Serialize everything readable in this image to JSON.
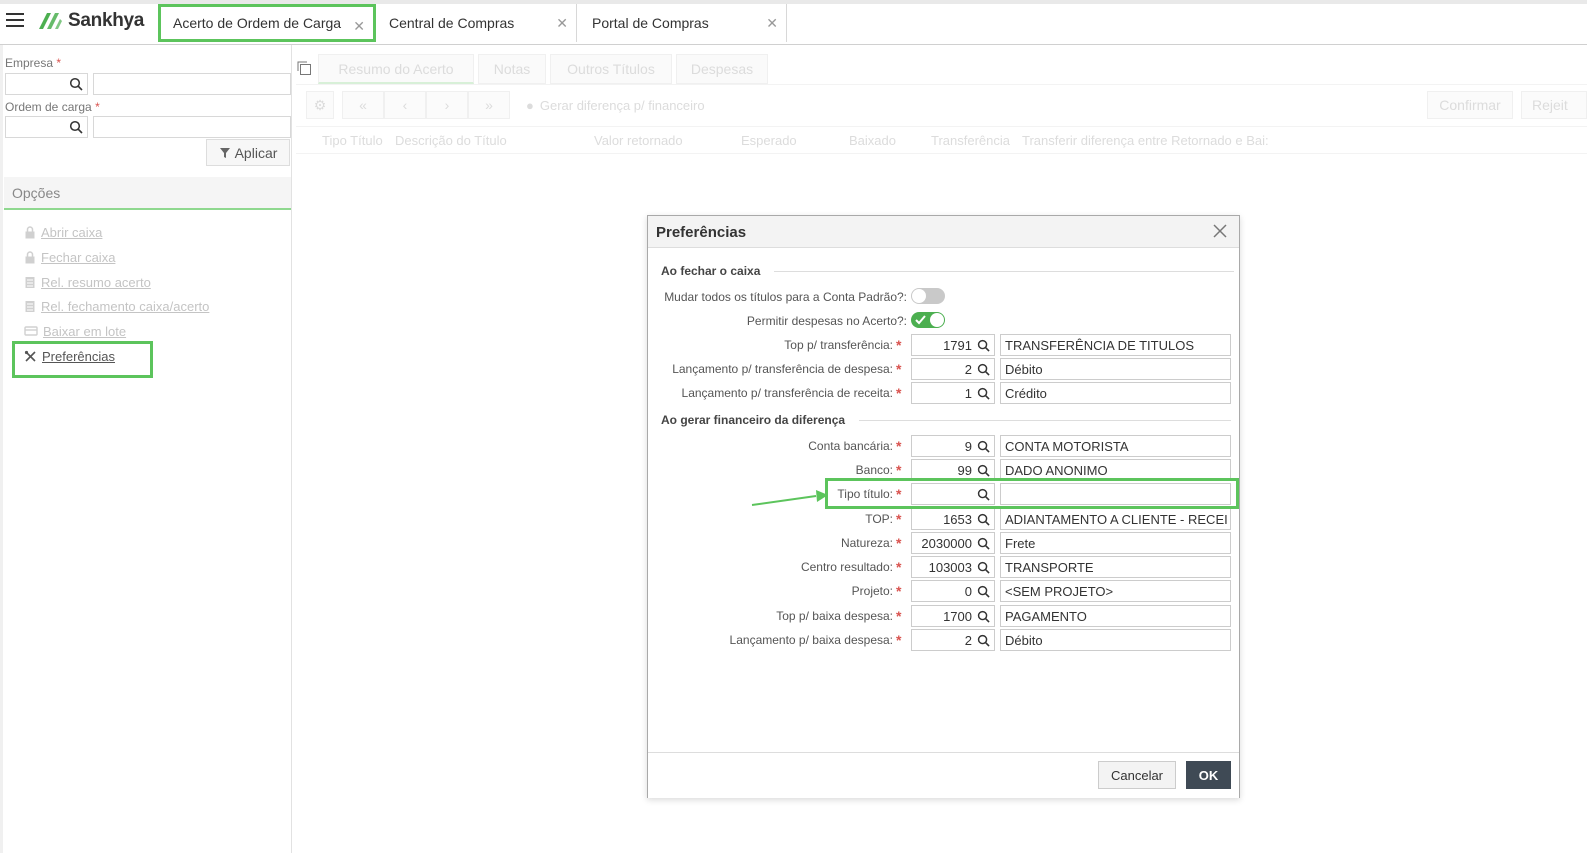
{
  "app": {
    "logo_text": "Sankhya",
    "accent_color": "#5cc45c"
  },
  "tabs": [
    {
      "label": "Acerto de Ordem de Carga",
      "close": "✕",
      "active": true
    },
    {
      "label": "Central de Compras",
      "close": "✕"
    },
    {
      "label": "Portal de Compras",
      "close": "✕"
    }
  ],
  "filters": {
    "empresa_label": "Empresa",
    "ordem_label": "Ordem de carga",
    "required_mark": "*",
    "aplicar_label": "Aplicar"
  },
  "options": {
    "header": "Opções",
    "items": [
      {
        "label": "Abrir caixa",
        "icon": "lock-icon"
      },
      {
        "label": "Fechar caixa",
        "icon": "lock-icon"
      },
      {
        "label": "Rel. resumo acerto",
        "icon": "report-icon"
      },
      {
        "label": "Rel. fechamento caixa/acerto",
        "icon": "report-icon"
      },
      {
        "label": "Baixar em lote",
        "icon": "card-icon"
      },
      {
        "label": "Preferências",
        "icon": "tools-icon"
      }
    ]
  },
  "main": {
    "tabs": [
      "Resumo do Acerto",
      "Notas",
      "Outros Títulos",
      "Despesas"
    ],
    "toolbar": {
      "gerar_label": "Gerar diferença p/ financeiro",
      "confirmar_label": "Confirmar",
      "rejeitar_label": "Rejeit"
    },
    "columns": [
      "Tipo Título",
      "Descrição do Título",
      "Valor retornado",
      "Esperado",
      "Baixado",
      "Transferência",
      "Transferir diferença entre Retornado e Bai:"
    ]
  },
  "dialog": {
    "title": "Preferências",
    "close": "✕",
    "section1": "Ao fechar o caixa",
    "toggles": [
      {
        "label": "Mudar todos os títulos para a Conta Padrão?:",
        "on": false
      },
      {
        "label": "Permitir despesas no Acerto?:",
        "on": true
      }
    ],
    "section1_fields": [
      {
        "label": "Top p/ transferência:",
        "code": "1791",
        "desc": "TRANSFERÊNCIA DE TITULOS"
      },
      {
        "label": "Lançamento p/ transferência de despesa:",
        "code": "2",
        "desc": "Débito"
      },
      {
        "label": "Lançamento p/ transferência de receita:",
        "code": "1",
        "desc": "Crédito"
      }
    ],
    "section2": "Ao gerar financeiro da diferença",
    "section2_fields": [
      {
        "label": "Conta bancária:",
        "code": "9",
        "desc": "CONTA MOTORISTA"
      },
      {
        "label": "Banco:",
        "code": "99",
        "desc": "DADO ANONIMO"
      },
      {
        "label": "Tipo título:",
        "code": "",
        "desc": ""
      },
      {
        "label": "TOP:",
        "code": "1653",
        "desc": "ADIANTAMENTO A CLIENTE - RECEI"
      },
      {
        "label": "Natureza:",
        "code": "2030000",
        "desc": "Frete"
      },
      {
        "label": "Centro resultado:",
        "code": "103003",
        "desc": "TRANSPORTE"
      },
      {
        "label": "Projeto:",
        "code": "0",
        "desc": "<SEM PROJETO>"
      },
      {
        "label": "Top p/ baixa despesa:",
        "code": "1700",
        "desc": "PAGAMENTO"
      },
      {
        "label": "Lançamento p/ baixa despesa:",
        "code": "2",
        "desc": "Débito"
      }
    ],
    "required_mark": "*",
    "cancel_label": "Cancelar",
    "ok_label": "OK"
  }
}
